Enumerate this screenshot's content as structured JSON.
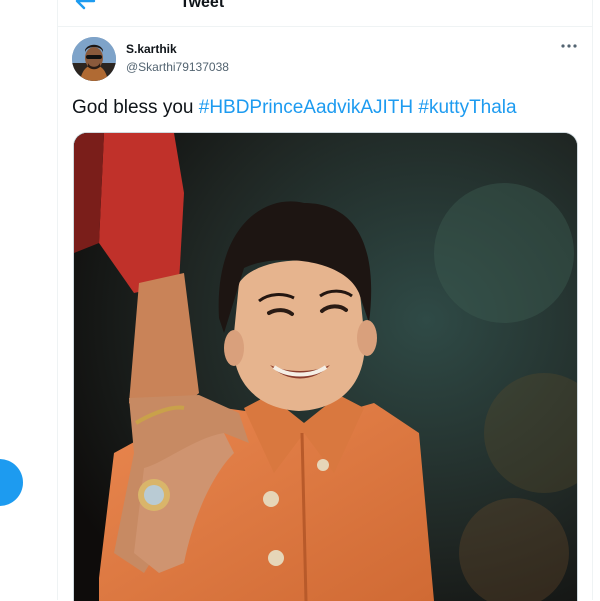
{
  "header": {
    "title": "Tweet",
    "back_icon": "arrow-left-icon"
  },
  "tweet": {
    "author_name": "S.karthik",
    "author_handle": "@Skarthi79137038",
    "more_icon": "more-horizontal-icon",
    "text_plain": "God bless you ",
    "hashtags": [
      "#HBDPrinceAadvikAJITH",
      "#kuttyThala"
    ],
    "media": {
      "kind": "photo",
      "subject": "smiling boy in orange kurta, adult hand with ring on shoulder"
    }
  },
  "compose_button": {
    "icon": "feather-icon"
  },
  "colors": {
    "accent": "#1d9bf0",
    "text": "#0f1419",
    "secondary": "#536471",
    "border": "#eff3f4"
  }
}
